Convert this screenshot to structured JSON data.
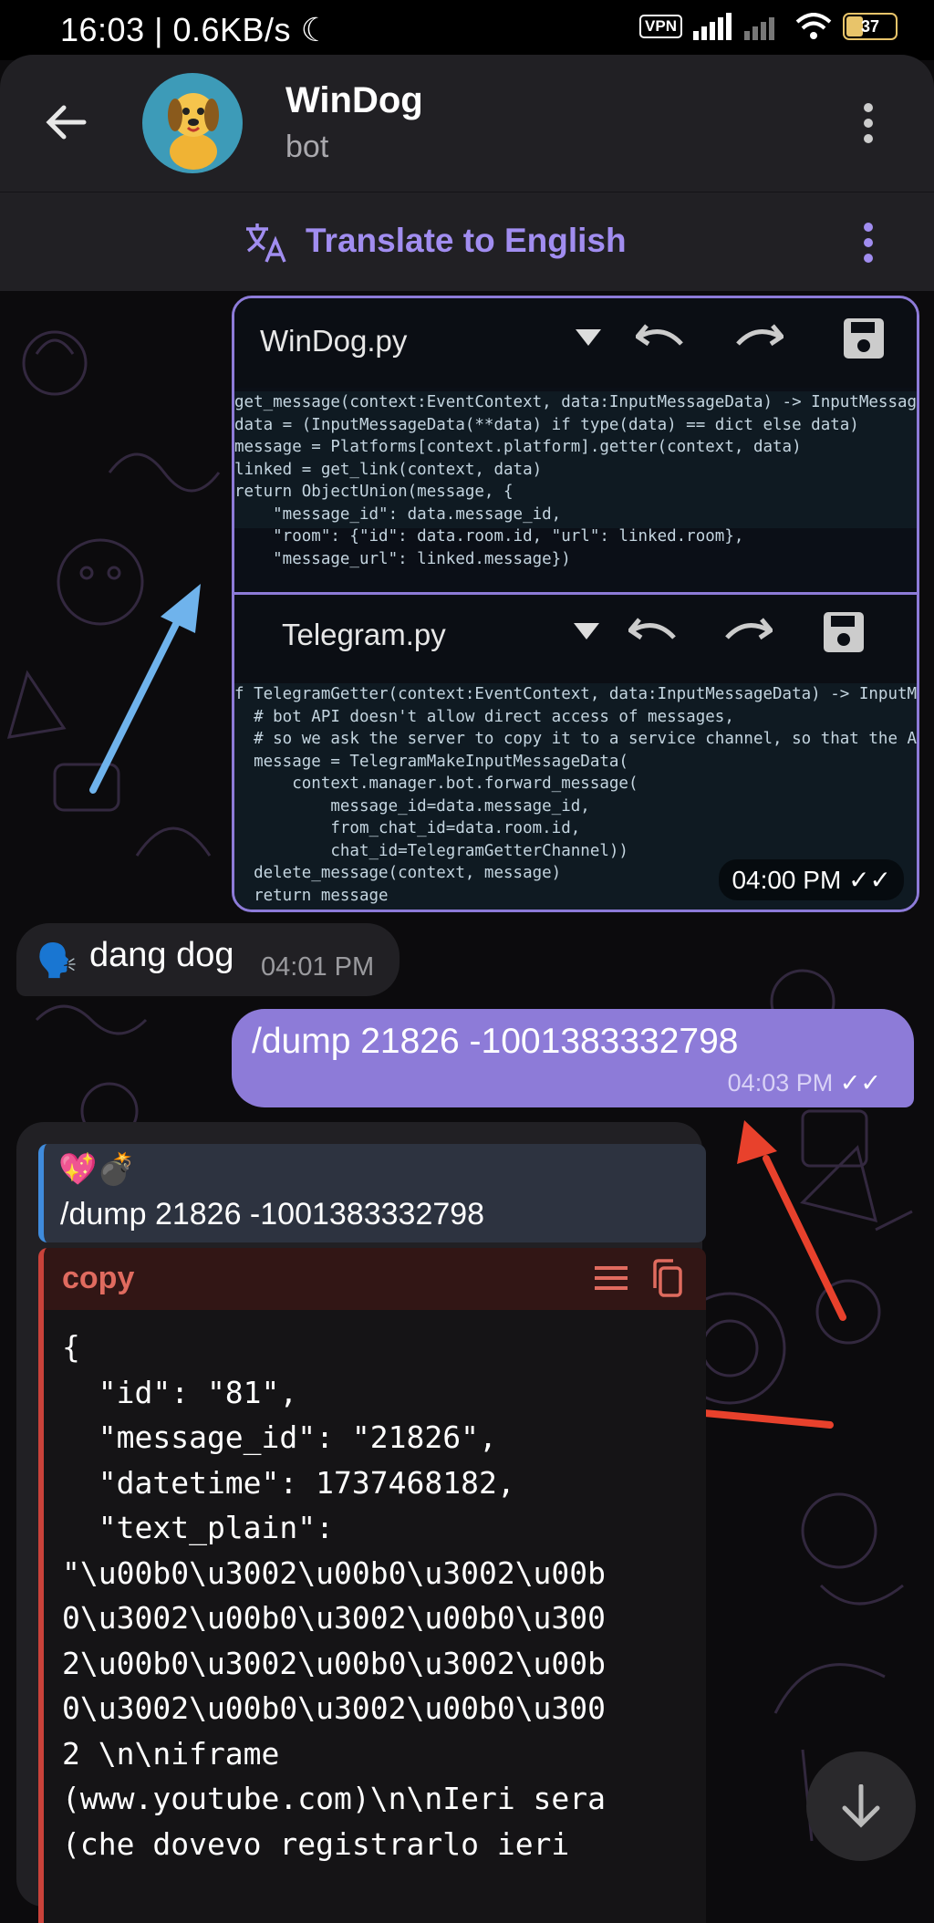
{
  "status_bar": {
    "time": "16:03",
    "speed": "0.6KB/s",
    "vpn": "VPN",
    "battery": "37"
  },
  "header": {
    "title": "WinDog",
    "subtitle": "bot"
  },
  "translate_bar": {
    "label": "Translate to English"
  },
  "screenshot_message": {
    "pane1_title": "WinDog.py",
    "pane1_code": [
      "get_message(context:EventContext, data:InputMessageData) -> InputMessag",
      "data = (InputMessageData(**data) if type(data) == dict else data)",
      "message = Platforms[context.platform].getter(context, data)",
      "linked = get_link(context, data)",
      "return ObjectUnion(message, {",
      "    \"message_id\": data.message_id,",
      "    \"room\": {\"id\": data.room.id, \"url\": linked.room},",
      "    \"message_url\": linked.message})"
    ],
    "pane2_title": "Telegram.py",
    "pane2_code": [
      "f TelegramGetter(context:EventContext, data:InputMessageData) -> InputMessag",
      "  # bot API doesn't allow direct access of messages,",
      "  # so we ask the server to copy it to a service channel, so that the API re",
      "  message = TelegramMakeInputMessageData(",
      "      context.manager.bot.forward_message(",
      "          message_id=data.message_id,",
      "          from_chat_id=data.room.id,",
      "          chat_id=TelegramGetterChannel))",
      "  delete_message(context, message)",
      "  return message"
    ],
    "time": "04:00 PM"
  },
  "incoming_message": {
    "emoji": "🗣️",
    "text": "dang dog",
    "time": "04:01 PM"
  },
  "outgoing_message": {
    "text": "/dump 21826 -1001383332798",
    "time": "04:03 PM"
  },
  "reply_message": {
    "quote_emojis": "💖💣",
    "quote_text": "/dump 21826 -1001383332798",
    "code_label": "copy",
    "json_lines": [
      "{",
      "  \"id\": \"81\",",
      "  \"message_id\": \"21826\",",
      "  \"datetime\": 1737468182,",
      "  \"text_plain\":",
      "\"\\u00b0\\u3002\\u00b0\\u3002\\u00b",
      "0\\u3002\\u00b0\\u3002\\u00b0\\u300",
      "2\\u00b0\\u3002\\u00b0\\u3002\\u00b",
      "0\\u3002\\u00b0\\u3002\\u00b0\\u300",
      "2 \\n\\niframe",
      "(www.youtube.com)\\n\\nIeri sera",
      "(che dovevo registrarlo ieri"
    ]
  },
  "icons": {
    "back": "back-arrow-icon",
    "menu": "more-vert-icon",
    "translate": "translate-icon",
    "dropdown": "dropdown-triangle-icon",
    "undo": "undo-icon",
    "redo": "redo-icon",
    "save": "save-icon",
    "wrap": "wrap-lines-icon",
    "copy": "copy-icon",
    "scroll_down": "arrow-down-icon"
  },
  "colors": {
    "accent": "#8d7bd8",
    "quote_border": "#3f8bdc",
    "code_border": "#c9423a",
    "annotation_red": "#e8412c",
    "annotation_blue": "#6fb3ec"
  }
}
